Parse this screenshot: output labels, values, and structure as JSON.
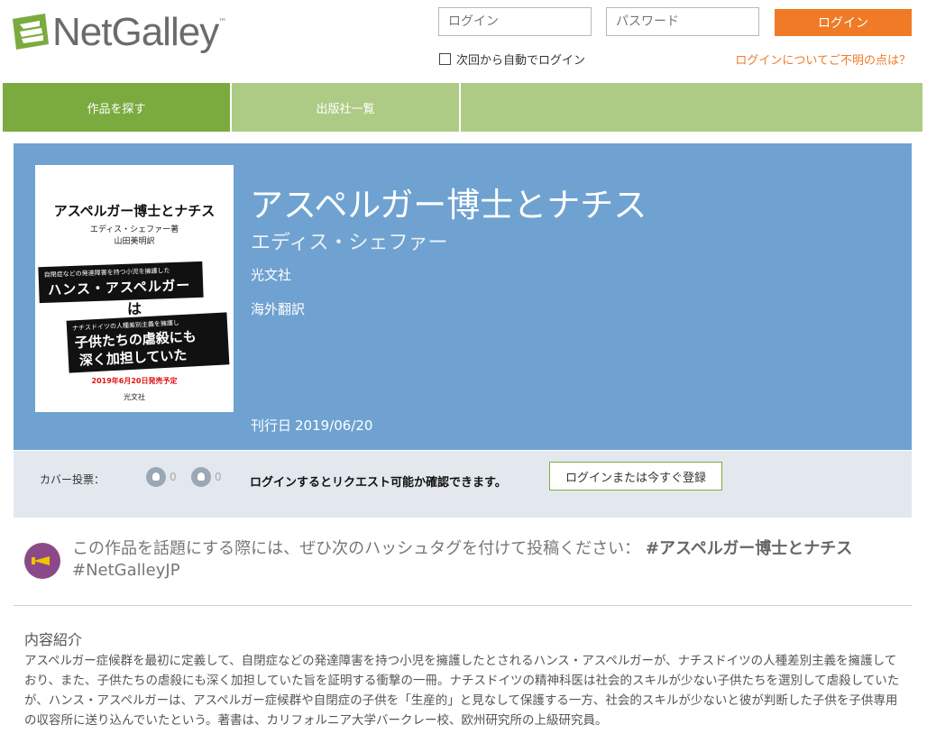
{
  "header": {
    "logo_text": "NetGalley",
    "logo_tm": "™",
    "username_placeholder": "ログイン",
    "password_placeholder": "パスワード",
    "login_button": "ログイン",
    "remember_label": "次回から自動でログイン",
    "help_link": "ログインについてご不明の点は？"
  },
  "nav": {
    "tabs": [
      {
        "label": "作品を探す",
        "active": true
      },
      {
        "label": "出版社一覧",
        "active": false
      }
    ]
  },
  "book": {
    "title": "アスペルガー博士とナチス",
    "author": "エディス・シェファー",
    "publisher": "光文社",
    "genre": "海外翻訳",
    "date_label": "刊行日",
    "date_value": "2019/06/20",
    "cover": {
      "title": "アスペルガー博士とナチス",
      "author_line": "エディス・シェファー著",
      "translator_line": "山田美明訳",
      "band1_small": "自閉症などの発達障害を持つ小児を擁護した",
      "band1_large": "ハンス・アスペルガー",
      "wa": "は",
      "band2_small": "ナチスドイツの人種差別主義を擁護し",
      "band2_line1": "子供たちの虐殺にも",
      "band2_line2": "深く加担していた",
      "release": "2019年6月20日発売予定",
      "publisher": "光文社"
    }
  },
  "actions": {
    "vote_label": "カバー投票：",
    "likes": "0",
    "dislikes": "0",
    "request_text": "ログインするとリクエスト可能か確認できます。",
    "register_button": "ログインまたは今すぐ登録"
  },
  "hashtag": {
    "prompt": "この作品を話題にする際には、ぜひ次のハッシュタグを付けて投稿ください：",
    "tag1": "#アスペルガー博士とナチス",
    "tag2": "#NetGalleyJP"
  },
  "description": {
    "heading": "内容紹介",
    "body": "アスペルガー症候群を最初に定義して、自閉症などの発達障害を持つ小児を擁護したとされるハンス・アスペルガーが、ナチスドイツの人種差別主義を擁護しており、また、子供たちの虐殺にも深く加担していた旨を証明する衝撃の一冊。ナチスドイツの精神科医は社会的スキルが少ない子供たちを選別して虐殺していたが、ハンス・アスペルガーは、アスペルガー症候群や自閉症の子供を「生産的」と見なして保護する一方、社会的スキルが少ないと彼が判断した子供を子供専用の収容所に送り込んでいたという。著書は、カリフォルニア大学バークレー校、欧州研究所の上級研究員。"
  },
  "colors": {
    "brand_green": "#7bab3f",
    "nav_light_green": "#aecb86",
    "hero_blue": "#6fa2d0",
    "accent_orange": "#f07a26",
    "hashtag_purple": "#8b4a87"
  }
}
